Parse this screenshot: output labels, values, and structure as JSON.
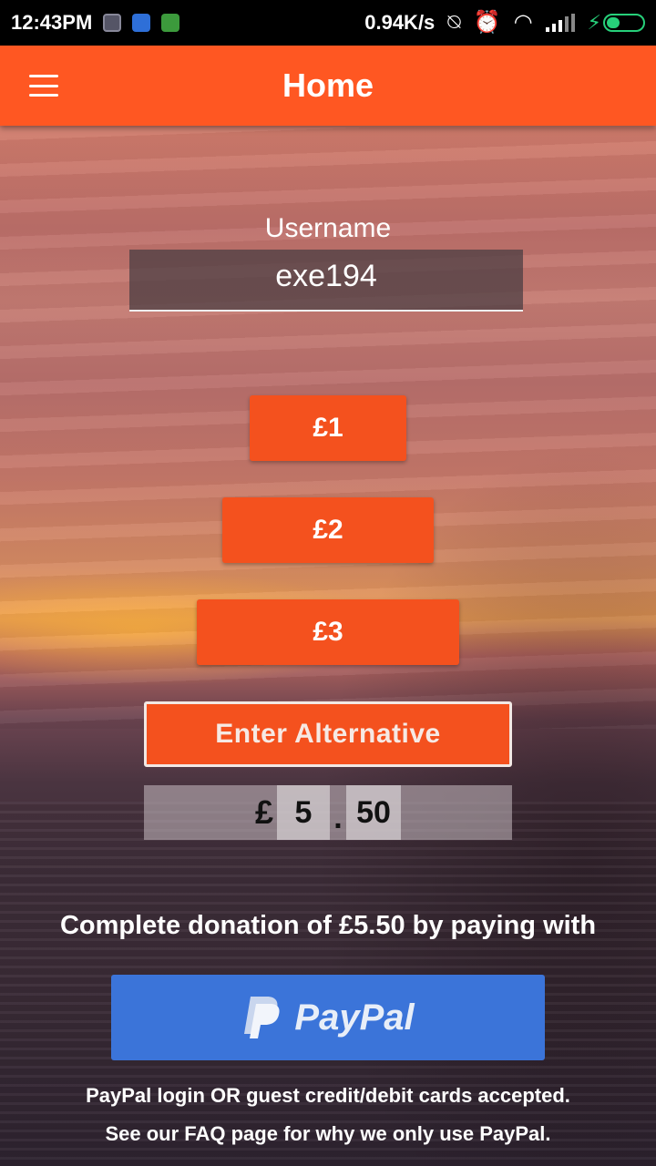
{
  "status_bar": {
    "time": "12:43PM",
    "network_speed": "0.94K/s",
    "icons": [
      "notification-icon",
      "shield-icon",
      "android-icon",
      "vibrate-off-icon",
      "alarm-icon",
      "wifi-icon",
      "signal-icon",
      "battery-charging-icon"
    ]
  },
  "app_bar": {
    "title": "Home",
    "menu_icon": "hamburger-menu-icon"
  },
  "username": {
    "label": "Username",
    "value": "exe194"
  },
  "amounts": {
    "option_1": "£1",
    "option_2": "£2",
    "option_3": "£3",
    "alternative_label": "Enter Alternative"
  },
  "custom_amount": {
    "currency": "£",
    "pounds": "5",
    "separator": ".",
    "pence": "50"
  },
  "donation": {
    "summary": "Complete donation of £5.50 by paying with",
    "paypal_label": "PayPal",
    "footer_line_1": "PayPal login OR guest credit/debit cards accepted.",
    "footer_line_2": "See our FAQ page for why we only use PayPal."
  },
  "colors": {
    "accent": "#ff5722",
    "button": "#f4511e",
    "paypal": "#3b74d9"
  }
}
